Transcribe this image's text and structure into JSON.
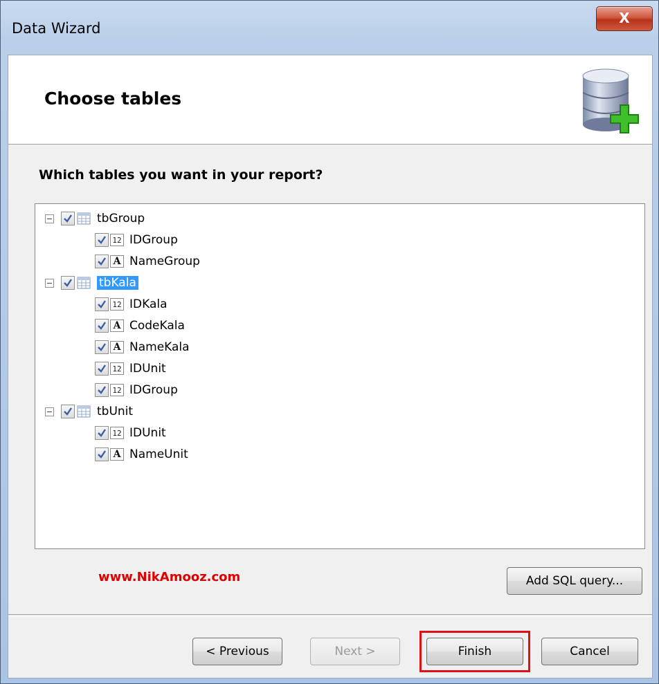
{
  "window": {
    "title": "Data Wizard",
    "close_label": "X"
  },
  "header": {
    "title": "Choose tables"
  },
  "prompt": "Which tables you want in your report?",
  "tree": {
    "tables": [
      {
        "name": "tbGroup",
        "checked": true,
        "selected": false,
        "fields": [
          {
            "name": "IDGroup",
            "type": "number",
            "checked": true
          },
          {
            "name": "NameGroup",
            "type": "text",
            "checked": true
          }
        ]
      },
      {
        "name": "tbKala",
        "checked": true,
        "selected": true,
        "fields": [
          {
            "name": "IDKala",
            "type": "number",
            "checked": true
          },
          {
            "name": "CodeKala",
            "type": "text",
            "checked": true
          },
          {
            "name": "NameKala",
            "type": "text",
            "checked": true
          },
          {
            "name": "IDUnit",
            "type": "number",
            "checked": true
          },
          {
            "name": "IDGroup",
            "type": "number",
            "checked": true
          }
        ]
      },
      {
        "name": "tbUnit",
        "checked": true,
        "selected": false,
        "fields": [
          {
            "name": "IDUnit",
            "type": "number",
            "checked": true
          },
          {
            "name": "NameUnit",
            "type": "text",
            "checked": true
          }
        ]
      }
    ],
    "number_icon_label": "12",
    "text_icon_label": "A"
  },
  "watermark": "www.NikAmooz.com",
  "buttons": {
    "add_sql": "Add SQL query...",
    "previous": "< Previous",
    "next": "Next >",
    "finish": "Finish",
    "cancel": "Cancel"
  },
  "colors": {
    "highlight": "#e0101a",
    "selection": "#3399ff",
    "watermark": "#e00000"
  }
}
